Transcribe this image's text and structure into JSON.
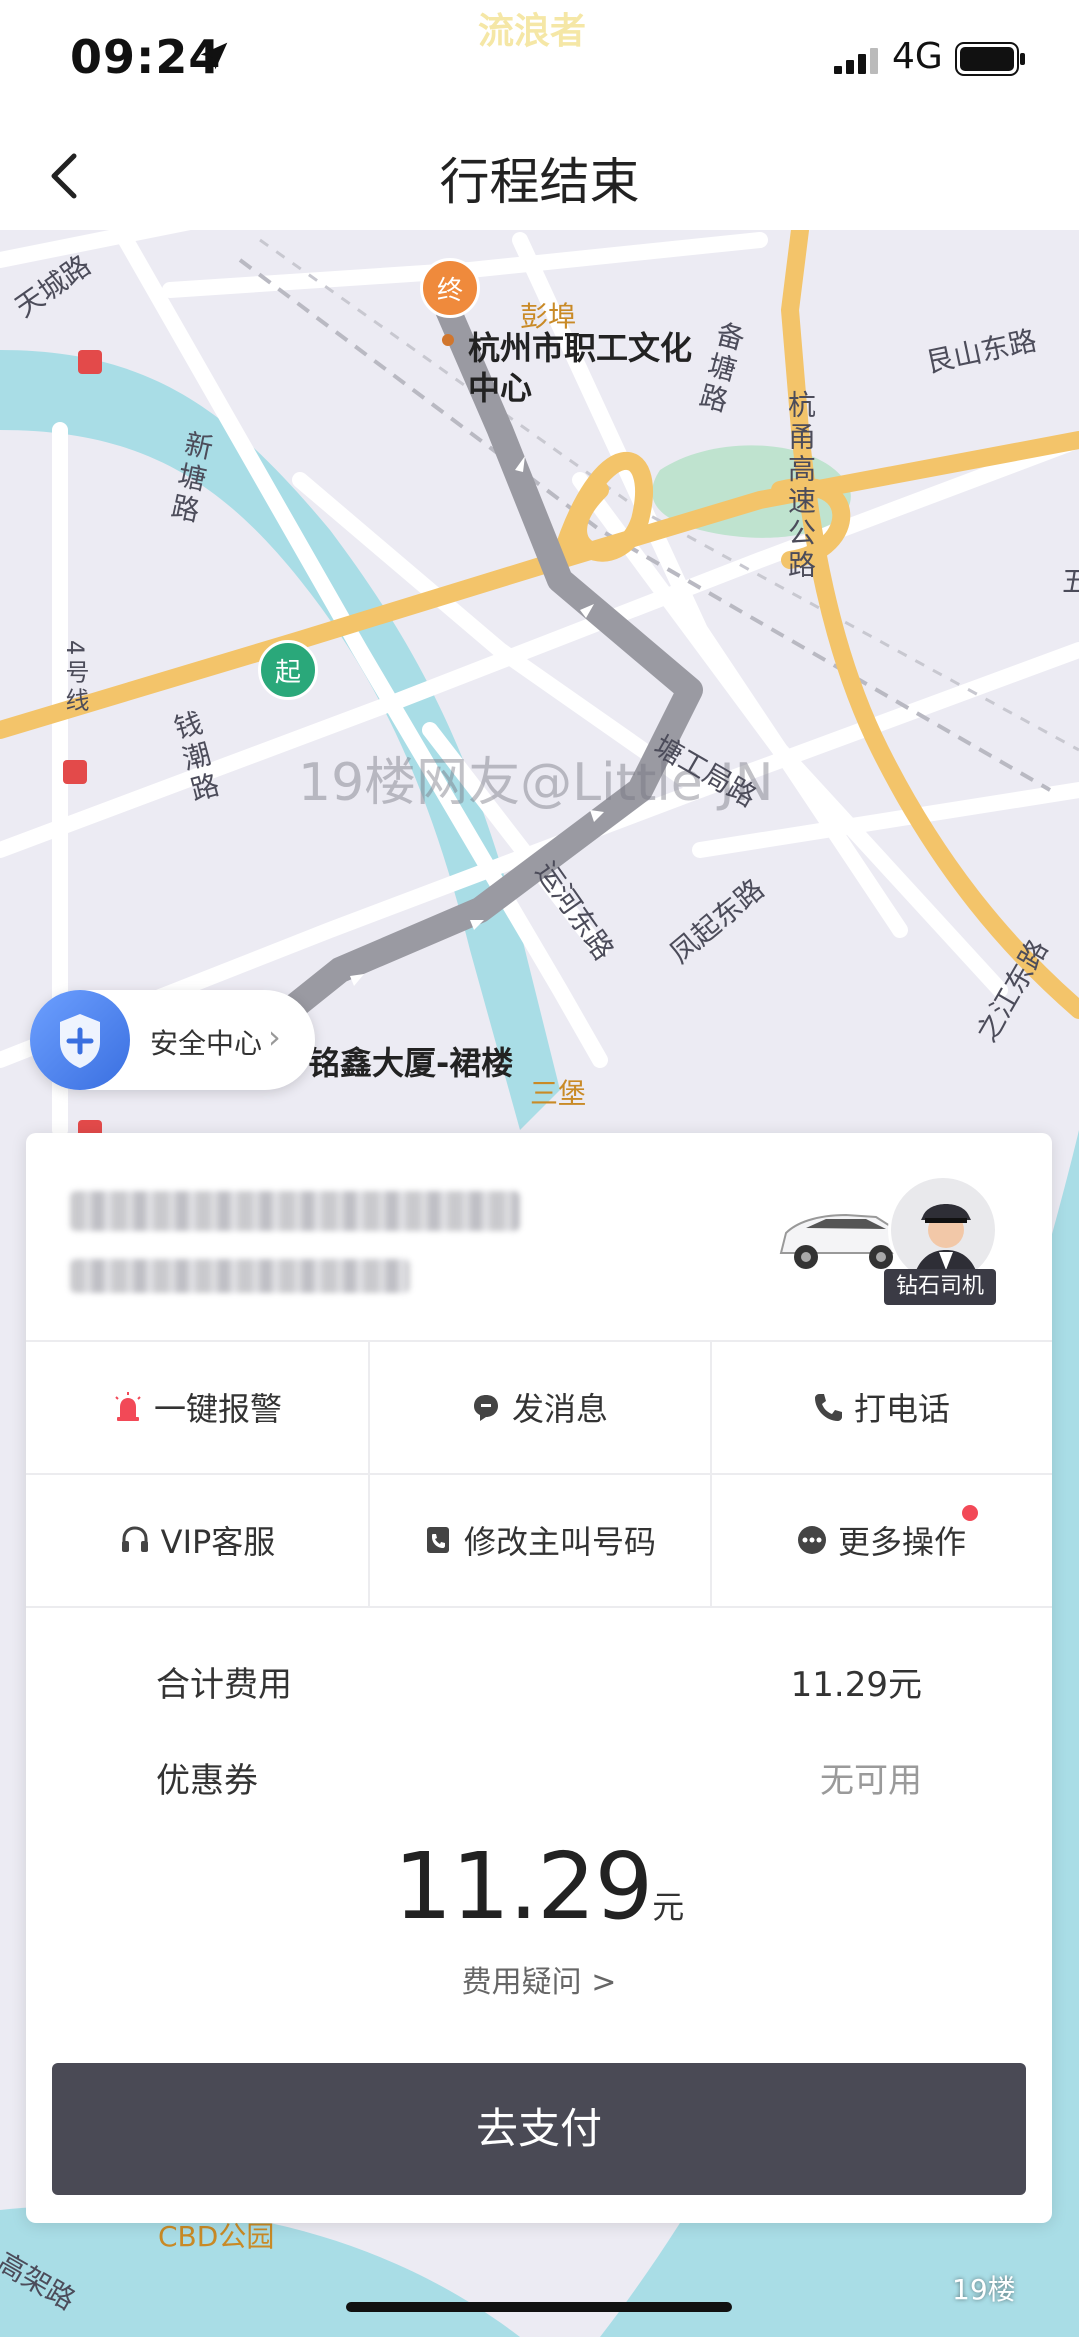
{
  "status_bar": {
    "time": "09:24",
    "network": "4G",
    "watermark_top": "流浪者"
  },
  "nav": {
    "title": "行程结束"
  },
  "map": {
    "watermark": "19楼网友@Little JN",
    "end_marker": "终",
    "start_marker": "起",
    "end_place": "杭州市职工文化中心",
    "start_place": "铭鑫大厦-裙楼",
    "labels": {
      "tiancheng": "天城路",
      "pengbu": "彭埠",
      "beitang": "备塘路",
      "genshan": "艮山东路",
      "xintang": "新塘路",
      "hangyong": "杭甬高速公路",
      "line4": "4号线",
      "qiancao": "钱潮路",
      "tanggong": "塘工局路",
      "yunhe": "运河东路",
      "fengqi": "凤起东路",
      "zhijiang": "之江东路",
      "sanbao": "三堡",
      "cbd": "CBD公园",
      "gaojia": "高架路",
      "edge": "五"
    },
    "safety_center": "安全中心"
  },
  "card": {
    "driver_badge": "钻石司机",
    "actions": [
      {
        "label": "一键报警",
        "icon": "alarm-icon"
      },
      {
        "label": "发消息",
        "icon": "message-icon"
      },
      {
        "label": "打电话",
        "icon": "phone-icon"
      },
      {
        "label": "VIP客服",
        "icon": "headset-icon"
      },
      {
        "label": "修改主叫号码",
        "icon": "phone-book-icon"
      },
      {
        "label": "更多操作",
        "icon": "more-icon"
      }
    ],
    "fee": {
      "total_label": "合计费用",
      "total_value": "11.29元",
      "coupon_label": "优惠券",
      "coupon_value": "无可用",
      "amount": "11.29",
      "unit": "元",
      "question": "费用疑问 >"
    },
    "pay_button": "去支付"
  },
  "corner_watermark": "19楼"
}
